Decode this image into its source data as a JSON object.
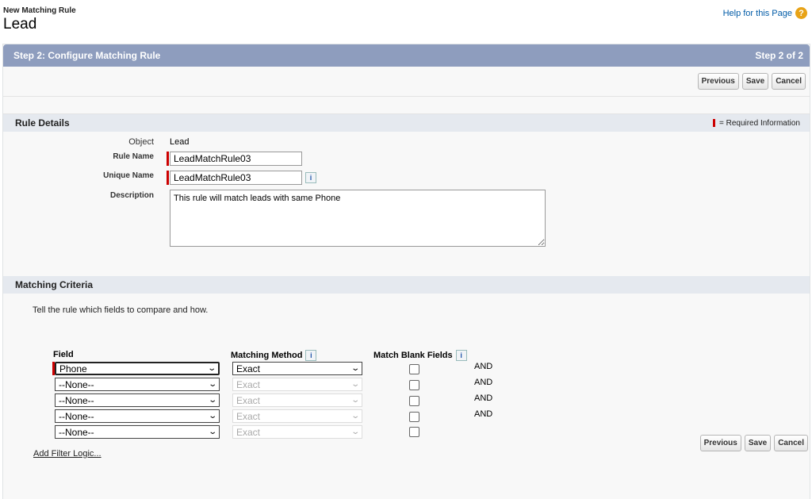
{
  "header": {
    "subtitle": "New Matching Rule",
    "title": "Lead",
    "help_link": "Help for this Page",
    "help_icon": "?"
  },
  "step_bar": {
    "title": "Step 2: Configure Matching Rule",
    "step_counter": "Step 2 of 2"
  },
  "buttons": {
    "previous": "Previous",
    "save": "Save",
    "cancel": "Cancel"
  },
  "rule_details": {
    "heading": "Rule Details",
    "required_legend": "= Required Information",
    "object_label": "Object",
    "object_value": "Lead",
    "rule_name_label": "Rule Name",
    "rule_name_value": "LeadMatchRule03",
    "unique_name_label": "Unique Name",
    "unique_name_value": "LeadMatchRule03",
    "description_label": "Description",
    "description_value": "This rule will match leads with same Phone",
    "info_icon": "i"
  },
  "matching_criteria": {
    "heading": "Matching Criteria",
    "intro": "Tell the rule which fields to compare and how.",
    "col_field": "Field",
    "col_method": "Matching Method",
    "col_blank": "Match Blank Fields",
    "rows": [
      {
        "field": "Phone",
        "method": "Exact",
        "logic": "AND"
      },
      {
        "field": "--None--",
        "method": "Exact",
        "logic": "AND"
      },
      {
        "field": "--None--",
        "method": "Exact",
        "logic": "AND"
      },
      {
        "field": "--None--",
        "method": "Exact",
        "logic": "AND"
      },
      {
        "field": "--None--",
        "method": "Exact",
        "logic": ""
      }
    ],
    "add_filter_logic": "Add Filter Logic..."
  },
  "colors": {
    "step_bar": "#8e9dbe",
    "section_header": "#e5e9ef",
    "required": "#cc0000",
    "help_link": "#015ba7"
  }
}
